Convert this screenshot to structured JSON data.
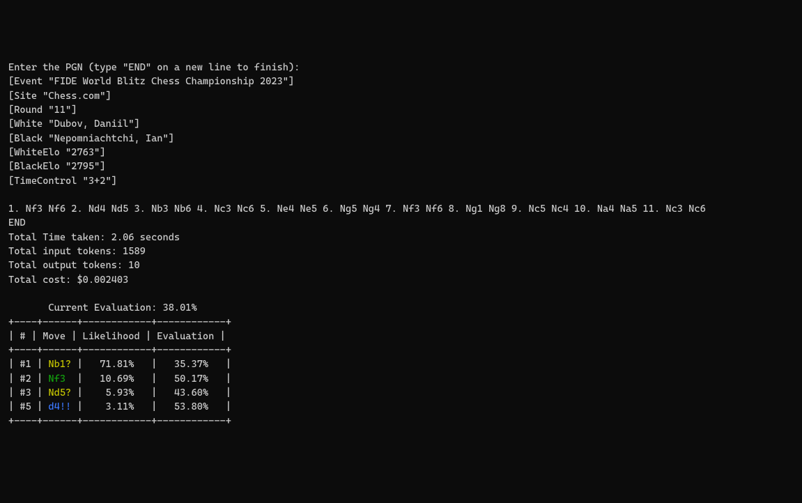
{
  "prompt": "Enter the PGN (type \"END\" on a new line to finish):",
  "pgn_headers": [
    "[Event \"FIDE World Blitz Chess Championship 2023\"]",
    "[Site \"Chess.com\"]",
    "[Round \"11\"]",
    "[White \"Dubov, Daniil\"]",
    "[Black \"Nepomniachtchi, Ian\"]",
    "[WhiteElo \"2763\"]",
    "[BlackElo \"2795\"]",
    "[TimeControl \"3+2\"]"
  ],
  "blank_line": "",
  "moveline": "1. Nf3 Nf6 2. Nd4 Nd5 3. Nb3 Nb6 4. Nc3 Nc6 5. Ne4 Ne5 6. Ng5 Ng4 7. Nf3 Nf6 8. Ng1 Ng8 9. Nc5 Nc4 10. Na4 Na5 11. Nc3 Nc6",
  "endline": "END",
  "stats": {
    "time": "Total Time taken: 2.06 seconds",
    "in": "Total input tokens: 1589",
    "out": "Total output tokens: 10",
    "cost": "Total cost: $0.002403"
  },
  "eval_header": "       Current Evaluation: 38.01%",
  "border": "+----+------+------------+------------+",
  "table_header": {
    "idx": " # ",
    "move": " Move ",
    "lik": " Likelihood ",
    "eval": " Evaluation "
  },
  "rows": [
    {
      "rank": " #1 ",
      "move": " Nb1? ",
      "color": "yellow",
      "lik": "   71.81%   ",
      "eval": "   35.37%   "
    },
    {
      "rank": " #2 ",
      "move": " Nf3  ",
      "color": "green",
      "lik": "   10.69%   ",
      "eval": "   50.17%   "
    },
    {
      "rank": " #3 ",
      "move": " Nd5? ",
      "color": "yellow",
      "lik": "    5.93%   ",
      "eval": "   43.60%   "
    },
    {
      "rank": " #5 ",
      "move": " d4!! ",
      "color": "blue",
      "lik": "    3.11%   ",
      "eval": "   53.80%   "
    }
  ],
  "pipe": "|"
}
